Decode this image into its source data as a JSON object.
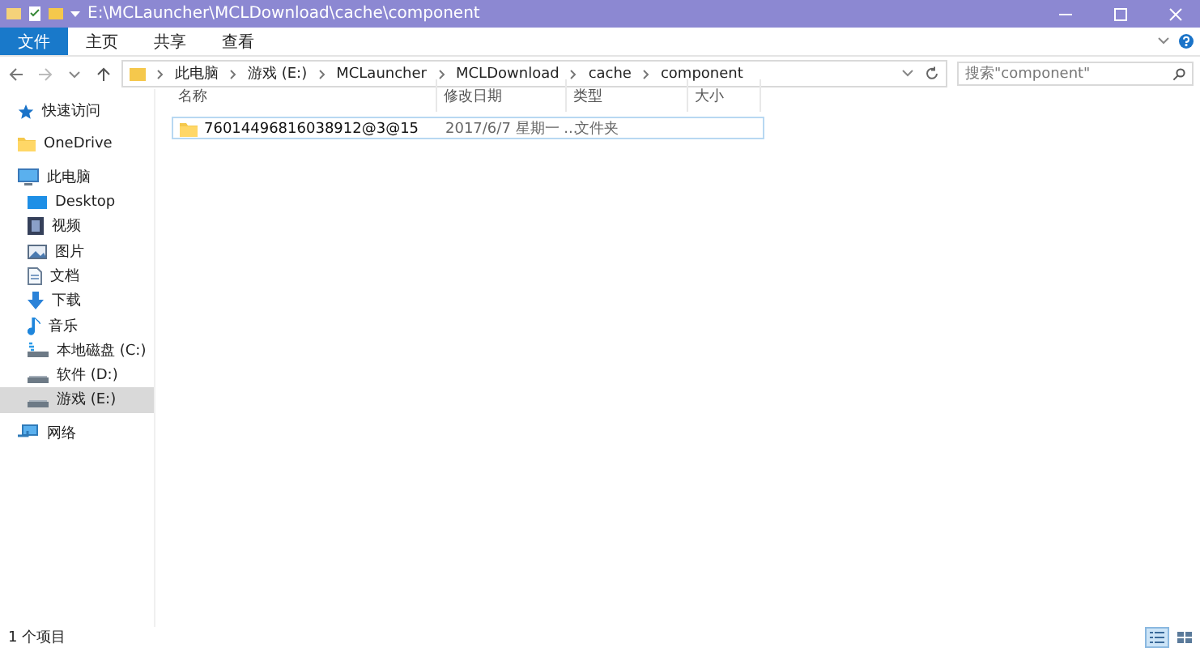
{
  "window": {
    "title": "E:\\MCLauncher\\MCLDownload\\cache\\component"
  },
  "ribbon_tabs": [
    {
      "label": "文件",
      "selected": true
    },
    {
      "label": "主页",
      "selected": false
    },
    {
      "label": "共享",
      "selected": false
    },
    {
      "label": "查看",
      "selected": false
    }
  ],
  "address": {
    "path": [
      "此电脑",
      "游戏 (E:)",
      "MCLauncher",
      "MCLDownload",
      "cache",
      "component"
    ]
  },
  "search": {
    "placeholder": "搜索\"component\""
  },
  "sidebar": {
    "items": [
      {
        "label": "快速访问",
        "kind": "star",
        "selected": false
      },
      {
        "label": "OneDrive",
        "kind": "folder",
        "selected": false
      },
      {
        "label": "此电脑",
        "kind": "pc",
        "selected": false,
        "children": [
          {
            "label": "Desktop",
            "kind": "desktop",
            "selected": false
          },
          {
            "label": "视频",
            "kind": "video",
            "selected": false
          },
          {
            "label": "图片",
            "kind": "picture",
            "selected": false
          },
          {
            "label": "文档",
            "kind": "document",
            "selected": false
          },
          {
            "label": "下载",
            "kind": "download",
            "selected": false
          },
          {
            "label": "音乐",
            "kind": "music",
            "selected": false
          },
          {
            "label": "本地磁盘 (C:)",
            "kind": "systemdisk",
            "selected": false
          },
          {
            "label": "软件 (D:)",
            "kind": "disk",
            "selected": false
          },
          {
            "label": "游戏 (E:)",
            "kind": "disk",
            "selected": true
          }
        ]
      },
      {
        "label": "网络",
        "kind": "network",
        "selected": false
      }
    ]
  },
  "file_list": {
    "columns": [
      "名称",
      "修改日期",
      "类型",
      "大小"
    ],
    "rows": [
      {
        "name": "76014496816038912@3@15",
        "date": "2017/6/7 星期一 ...",
        "type": "文件夹",
        "focused": true
      }
    ]
  },
  "status_bar": {
    "text": "1 个项目",
    "views": [
      {
        "kind": "details",
        "selected": true
      },
      {
        "kind": "icons",
        "selected": false
      }
    ]
  }
}
